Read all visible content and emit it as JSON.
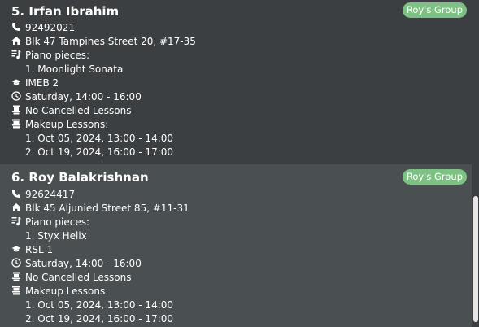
{
  "students": [
    {
      "title": "5. Irfan Ibrahim",
      "tag": "Roy's Group",
      "phone": "92492021",
      "address": "Blk 47 Tampines Street 20, #17-35",
      "pieces_label": "Piano pieces:",
      "pieces": [
        "1. Moonlight Sonata"
      ],
      "grade": "IMEB 2",
      "lesson_time": "Saturday, 14:00 - 16:00",
      "cancelled": "No Cancelled Lessons",
      "makeup_label": "Makeup Lessons:",
      "makeup": [
        "1. Oct 05, 2024, 13:00 - 14:00",
        "2. Oct 19, 2024, 16:00 - 17:00"
      ]
    },
    {
      "title": "6. Roy Balakrishnan",
      "tag": "Roy's Group",
      "phone": "92624417",
      "address": "Blk 45 Aljunied Street 85, #11-31",
      "pieces_label": "Piano pieces:",
      "pieces": [
        "1. Styx Helix"
      ],
      "grade": "RSL 1",
      "lesson_time": "Saturday, 14:00 - 16:00",
      "cancelled": "No Cancelled Lessons",
      "makeup_label": "Makeup Lessons:",
      "makeup": [
        "1. Oct 05, 2024, 13:00 - 14:00",
        "2. Oct 19, 2024, 16:00 - 17:00"
      ]
    }
  ],
  "colors": {
    "tag_bg": "#7ec184",
    "card_bg": "#3c3f41",
    "card_selected_bg": "#4a5051"
  },
  "icons": [
    "phone-icon",
    "home-icon",
    "music-icon",
    "graduation-cap-icon",
    "clock-icon",
    "calendar-x-icon",
    "calendar-makeup-icon"
  ]
}
